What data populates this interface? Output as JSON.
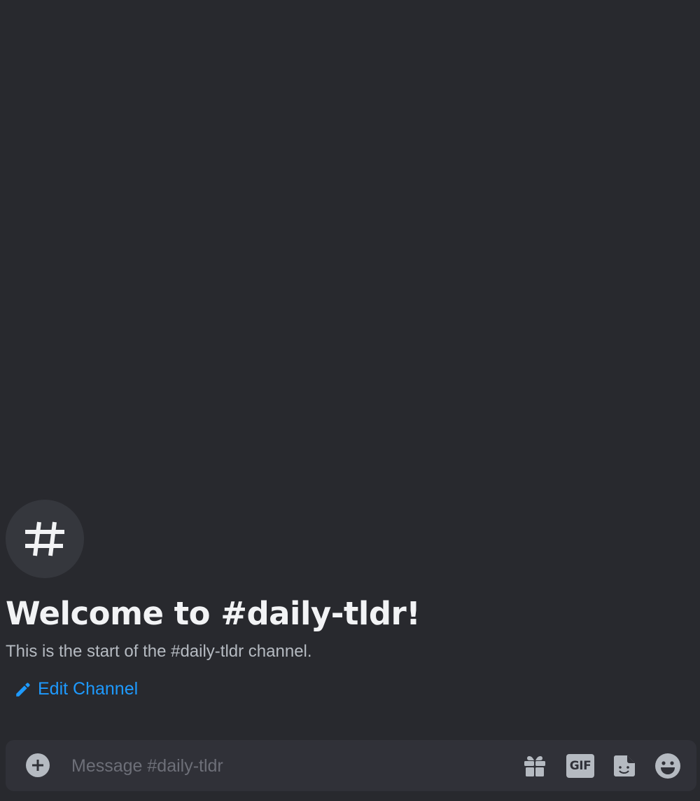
{
  "channel": {
    "welcome_title": "Welcome to #daily-tldr!",
    "welcome_subtitle": "This is the start of the #daily-tldr channel.",
    "edit_label": "Edit Channel",
    "icon": "hashtag-icon"
  },
  "composer": {
    "placeholder": "Message #daily-tldr",
    "value": "",
    "gif_label": "GIF",
    "icons": [
      "add-attachment-icon",
      "gift-icon",
      "gif-icon",
      "sticker-icon",
      "emoji-icon"
    ]
  },
  "colors": {
    "background": "#28292e",
    "composer_bg": "#303138",
    "link_blue": "#1e9aff",
    "title_text": "#f2f3f5",
    "muted_text": "#b5bac1",
    "icon_circle": "#35373d"
  }
}
